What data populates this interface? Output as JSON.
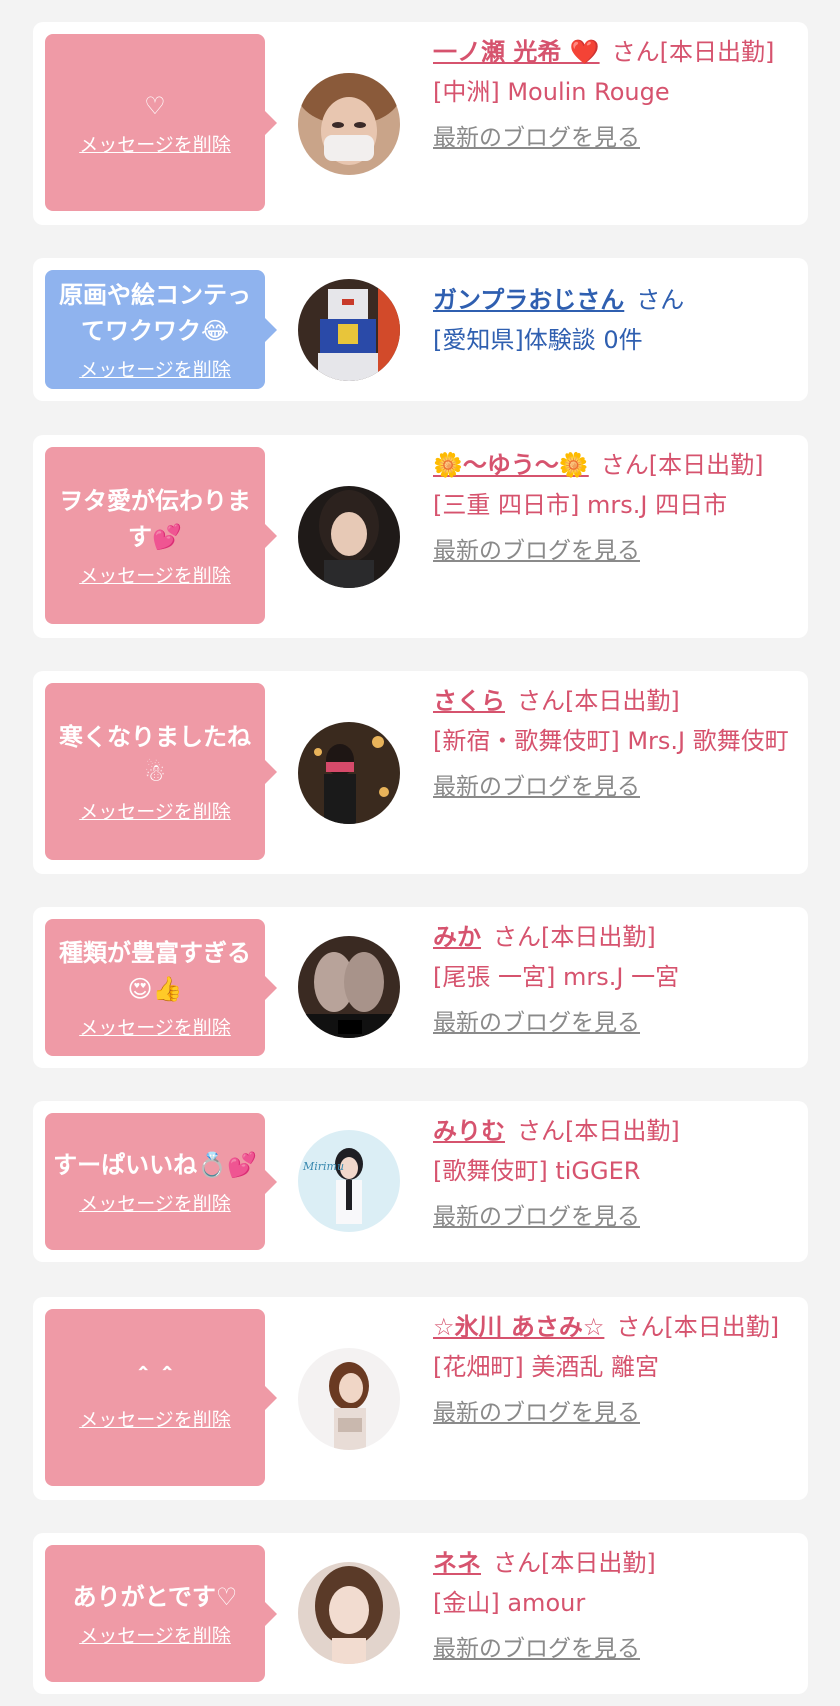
{
  "cards": [
    {
      "message": "♡",
      "delete_label": "メッセージを削除",
      "name": "一ノ瀬 光希 ❤️",
      "suffix": "さん[本日出勤]",
      "shop": "[中洲] Moulin Rouge",
      "blog": "最新のブログを見る"
    },
    {
      "message": "原画や絵コンテってワクワク😂",
      "delete_label": "メッセージを削除",
      "name": "ガンプラおじさん",
      "suffix": "さん",
      "shop": "[愛知県]体験談 0件"
    },
    {
      "message": "ヲタ愛が伝わります💕",
      "delete_label": "メッセージを削除",
      "name": "🌼〜ゆう〜🌼",
      "suffix": "さん[本日出勤]",
      "shop": "[三重 四日市] mrs.J 四日市",
      "blog": "最新のブログを見る"
    },
    {
      "message": "寒くなりましたね☃",
      "delete_label": "メッセージを削除",
      "name": "さくら",
      "suffix": "さん[本日出勤]",
      "shop": "[新宿・歌舞伎町] Mrs.J 歌舞伎町",
      "blog": "最新のブログを見る"
    },
    {
      "message": "種類が豊富すぎる😍👍",
      "delete_label": "メッセージを削除",
      "name": "みか",
      "suffix": "さん[本日出勤]",
      "shop": "[尾張 一宮] mrs.J 一宮",
      "blog": "最新のブログを見る"
    },
    {
      "message": "すーぱいいね💍💕",
      "delete_label": "メッセージを削除",
      "name": "みりむ",
      "suffix": "さん[本日出勤]",
      "shop": "[歌舞伎町] tiGGER",
      "blog": "最新のブログを見る"
    },
    {
      "message": "＾＾",
      "delete_label": "メッセージを削除",
      "name": "☆氷川 あさみ☆",
      "suffix": "さん[本日出勤]",
      "shop": "[花畑町] 美酒乱 離宮",
      "blog": "最新のブログを見る"
    },
    {
      "message": "ありがとです♡",
      "delete_label": "メッセージを削除",
      "name": "ネネ",
      "suffix": "さん[本日出勤]",
      "shop": "[金山] amour",
      "blog": "最新のブログを見る"
    }
  ],
  "avatar_6_text": "Mirimu",
  "colors": {
    "pink_bubble": "#ef9aa6",
    "blue_bubble": "#8fb3ee",
    "pink_text": "#d6536e",
    "blue_text": "#2f5fb0",
    "link_gray": "#8a8a8a"
  }
}
